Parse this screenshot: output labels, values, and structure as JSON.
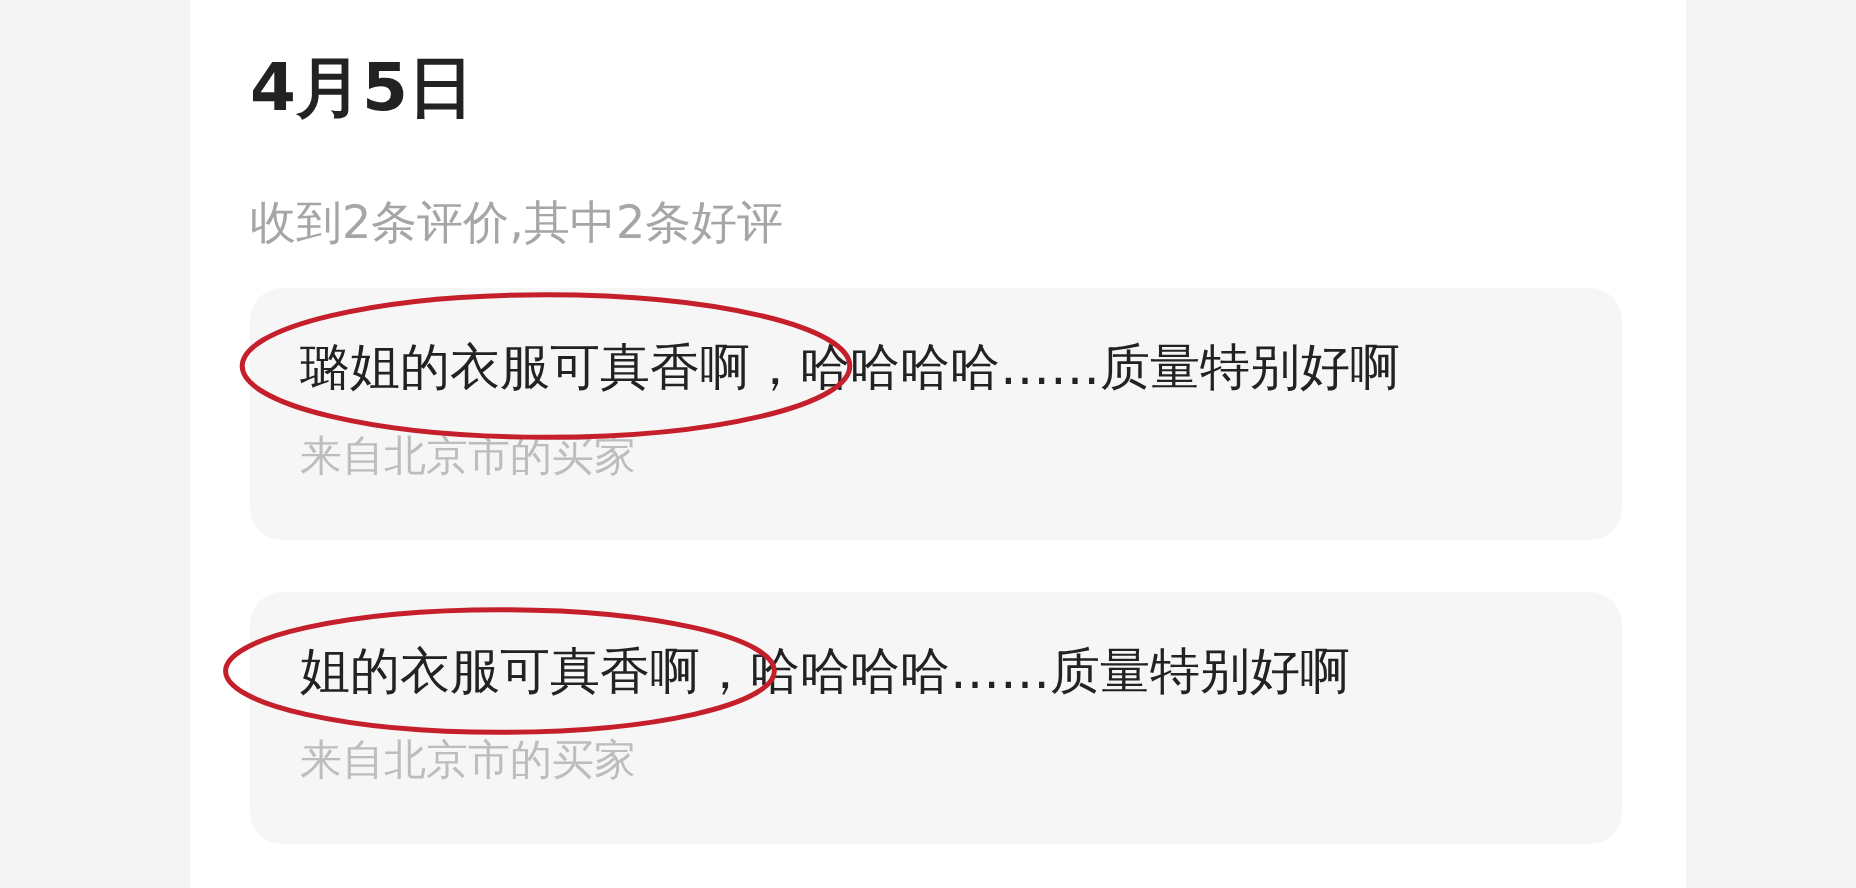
{
  "date": "4月5日",
  "summary": "收到2条评价,其中2条好评",
  "reviews": [
    {
      "text": "璐姐的衣服可真香啊，哈哈哈哈……质量特别好啊",
      "source": "来自北京市的买家",
      "circled": true
    },
    {
      "text": "姐的衣服可真香啊，哈哈哈哈……质量特别好啊",
      "source": "来自北京市的买家",
      "circled": true
    }
  ]
}
